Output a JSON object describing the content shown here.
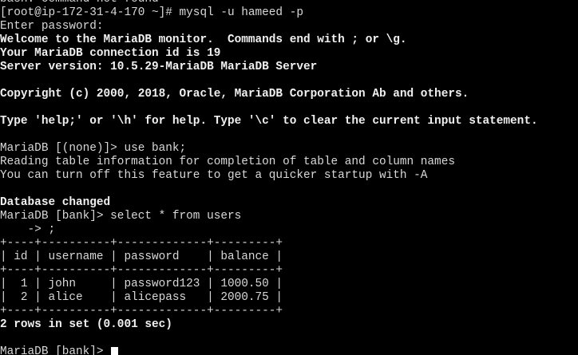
{
  "terminal": {
    "lines": [
      {
        "text": "bash: command not found",
        "bold": false
      },
      {
        "text": "[root@ip-172-31-4-170 ~]# mysql -u hameed -p",
        "bold": false
      },
      {
        "text": "Enter password:",
        "bold": false
      },
      {
        "text": "Welcome to the MariaDB monitor.  Commands end with ; or \\g.",
        "bold": true
      },
      {
        "text": "Your MariaDB connection id is 19",
        "bold": true
      },
      {
        "text": "Server version: 10.5.29-MariaDB MariaDB Server",
        "bold": true
      },
      {
        "text": "",
        "bold": false
      },
      {
        "text": "Copyright (c) 2000, 2018, Oracle, MariaDB Corporation Ab and others.",
        "bold": true
      },
      {
        "text": "",
        "bold": false
      },
      {
        "text": "Type 'help;' or '\\h' for help. Type '\\c' to clear the current input statement.",
        "bold": true
      },
      {
        "text": "",
        "bold": false
      },
      {
        "text": "MariaDB [(none)]> use bank;",
        "bold": false
      },
      {
        "text": "Reading table information for completion of table and column names",
        "bold": false
      },
      {
        "text": "You can turn off this feature to get a quicker startup with -A",
        "bold": false
      },
      {
        "text": "",
        "bold": false
      },
      {
        "text": "Database changed",
        "bold": true
      },
      {
        "text": "MariaDB [bank]> select * from users",
        "bold": false
      },
      {
        "text": "    -> ;",
        "bold": false
      },
      {
        "text": "+----+----------+-------------+---------+",
        "bold": false
      },
      {
        "text": "| id | username | password    | balance |",
        "bold": false
      },
      {
        "text": "+----+----------+-------------+---------+",
        "bold": false
      },
      {
        "text": "|  1 | john     | password123 | 1000.50 |",
        "bold": false
      },
      {
        "text": "|  2 | alice    | alicepass   | 2000.75 |",
        "bold": false
      },
      {
        "text": "+----+----------+-------------+---------+",
        "bold": false
      },
      {
        "text": "2 rows in set (0.001 sec)",
        "bold": true
      },
      {
        "text": "",
        "bold": false
      }
    ],
    "prompt": "MariaDB [bank]> "
  }
}
